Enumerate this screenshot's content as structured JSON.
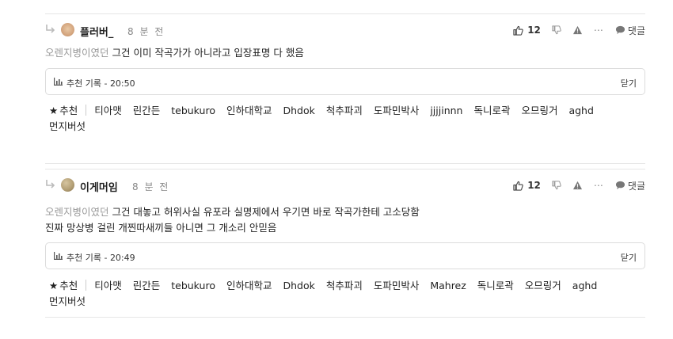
{
  "top_partial_text": "",
  "comments": [
    {
      "nickname": "플러버_",
      "time": "8 분 전",
      "likes": "12",
      "reply_label": "댓글",
      "tag": "오렌지병이였던",
      "lines": [
        "그건 이미 작곡가가 아니라고 입장표명 다 했음"
      ],
      "record_label": "추천 기록 - 20:50",
      "close_label": "닫기",
      "rec_title": "추천",
      "recommenders": [
        "티아맷",
        "린간든",
        "tebukuro",
        "인하대학교",
        "Dhdok",
        "척추파괴",
        "도파민박사",
        "jjjjinnn",
        "독니로곽",
        "오므링거",
        "aghd",
        "먼지버섯"
      ]
    },
    {
      "nickname": "이게머임",
      "time": "8 분 전",
      "likes": "12",
      "reply_label": "댓글",
      "tag": "오렌지병이였던",
      "lines": [
        "그건 대놓고 허위사실 유포라 실명제에서 우기면 바로 작곡가한테 고소당함",
        "진짜 망상병 걸린 개찐따새끼들 아니면 그 개소리 안믿음"
      ],
      "record_label": "추천 기록 - 20:49",
      "close_label": "닫기",
      "rec_title": "추천",
      "recommenders": [
        "티아맷",
        "린간든",
        "tebukuro",
        "인하대학교",
        "Dhdok",
        "척추파괴",
        "도파민박사",
        "Mahrez",
        "독니로곽",
        "오므링거",
        "aghd",
        "먼지버섯"
      ]
    }
  ]
}
